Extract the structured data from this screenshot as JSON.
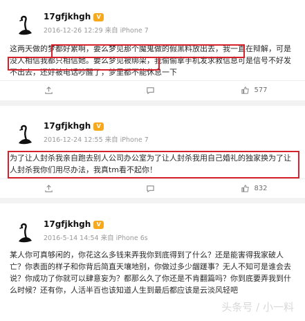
{
  "posts": [
    {
      "username": "17gfjkhgh",
      "vip_badge": "V",
      "meta": "2016-12-26 12:29 来自 iPhone 7",
      "text": "这两天做的梦都好累啊，要么梦见那个魔鬼做的假黑料放出去，我一直在辩解，可是没人相信我都只相信她。要么梦见被绑架，我偷偷拿手机发求救信息可是信号不好发不出去，还好被电话吵醒了，梦里都不能休息一下",
      "actions": {
        "share": "",
        "comment": "",
        "like": "577"
      }
    },
    {
      "username": "17gfjkhgh",
      "vip_badge": "V",
      "meta": "2016-12-24 12:55 来自 iPhone 7",
      "text": "为了让人封杀我亲自跑去别人公司办公室为了让人封杀我用自己婚礼的独家换为了让人封杀我你们用尽办法，我真tm看不起你！",
      "actions": {
        "share": "",
        "comment": "",
        "like": "832"
      }
    },
    {
      "username": "17gfjkhgh",
      "vip_badge": "V",
      "meta": "2016-5-14 14:54 来自 iPhone 6s",
      "text": "某人你可真够闲的，你花这么多钱来弄我你到底得到了什么？还是能害得我家破人亡？你表面的样子和你背后简直天壤地别，你做过多少龌蹉事？无人不知可是谁会去说？你成功了你就可以肆意妄为？都那么久了你还是不肯翻篇吗？你到底要弄我到什么时候？还有你，人活半百也该知道人生到最后都应该是云淡风轻吧"
    }
  ],
  "watermark": "头条号 / 小一料",
  "colors": {
    "highlight": "#d6202c",
    "vip": "#f7a81b"
  }
}
